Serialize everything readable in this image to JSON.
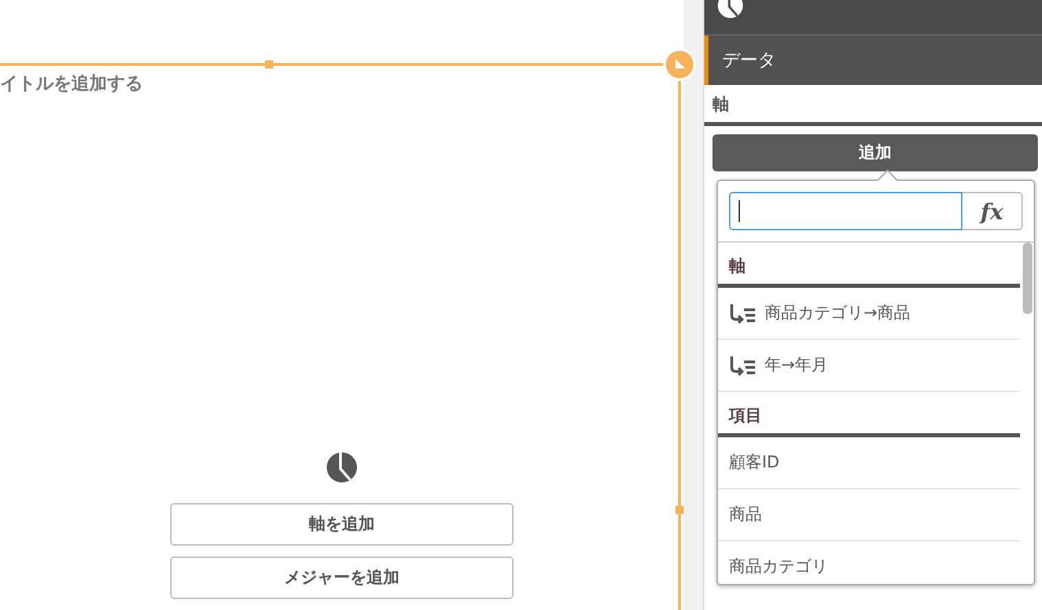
{
  "chart": {
    "title": "イトルを追加する",
    "buttons": [
      {
        "label": "軸を追加"
      },
      {
        "label": "メジャーを追加"
      }
    ]
  },
  "panel": {
    "tabs": [
      {
        "label": "データ",
        "selected": true
      }
    ],
    "section": "軸",
    "add_button": "追加"
  },
  "popup": {
    "fx_button": "fx",
    "groups": [
      {
        "title": "軸",
        "items": [
          {
            "label": "商品カテゴリ→商品",
            "kind": "drilldown"
          },
          {
            "label": "年→年月",
            "kind": "drilldown"
          }
        ]
      },
      {
        "title": "項目",
        "items": [
          {
            "label": "顧客ID",
            "kind": "field"
          },
          {
            "label": "商品",
            "kind": "field"
          },
          {
            "label": "商品カテゴリ",
            "kind": "field"
          }
        ]
      }
    ]
  }
}
